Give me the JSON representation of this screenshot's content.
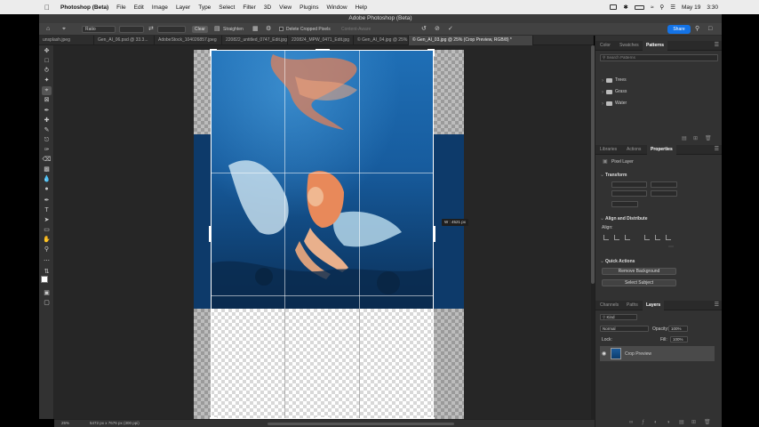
{
  "menubar": {
    "app_name": "Photoshop (Beta)",
    "items": [
      "File",
      "Edit",
      "Image",
      "Layer",
      "Type",
      "Select",
      "Filter",
      "3D",
      "View",
      "Plugins",
      "Window",
      "Help"
    ],
    "date": "May 19",
    "time": "3:30"
  },
  "window": {
    "title": "Adobe Photoshop (Beta)"
  },
  "options_bar": {
    "ratio": "Ratio",
    "clear": "Clear",
    "straighten": "Straighten",
    "delete_cropped": "Delete Cropped Pixels",
    "content_aware": "Content-Aware",
    "share": "Share"
  },
  "tabs": [
    "unsplash.jpeg",
    "Gen_AI_06.psd @ 33.3...",
    "AdobeStock_104026857.jpeg",
    "220822_untitled_0747_Edit.jpg",
    "220824_MPW_0471_Edit.jpg",
    "© Gen_AI_04.jpg @ 25%",
    "© Gen_AI_03.jpg @ 25% (Crop Preview, RGB/8) *"
  ],
  "canvas": {
    "width_readout": "W : 4521 px"
  },
  "status": {
    "zoom": "25%",
    "doc_size": "5472 px x 7676 px (300 ppi)"
  },
  "panels": {
    "top_tabs": [
      "Color",
      "Swatches",
      "Patterns"
    ],
    "patterns_search_placeholder": "Search Patterns",
    "pattern_groups": [
      "Trees",
      "Grass",
      "Water"
    ],
    "mid_tabs": [
      "Libraries",
      "Actions",
      "Properties"
    ],
    "properties": {
      "layer_kind": "Pixel Layer",
      "transform_label": "Transform",
      "align_label": "Align and Distribute",
      "align_sub": "Align:",
      "quick_actions_label": "Quick Actions",
      "remove_bg": "Remove Background",
      "select_subject": "Select Subject"
    },
    "bottom_tabs": [
      "Channels",
      "Paths",
      "Layers"
    ],
    "layers": {
      "kind_filter": "Kind",
      "blend_mode": "Normal",
      "opacity_label": "Opacity:",
      "opacity_value": "100%",
      "lock_label": "Lock:",
      "fill_label": "Fill:",
      "fill_value": "100%",
      "layer_name": "Crop Preview"
    }
  },
  "colors": {
    "accent": "#1473e6",
    "panel_bg": "#323232",
    "canvas_bg": "#262626"
  }
}
